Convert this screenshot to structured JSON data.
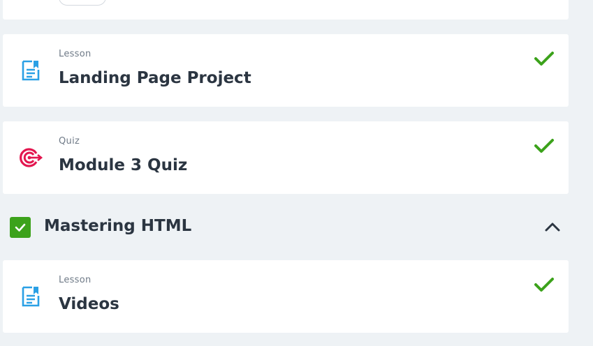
{
  "colors": {
    "background": "#eef2f5",
    "card": "#ffffff",
    "check_green": "#3ca21b",
    "lesson_blue": "#2aa0e5",
    "quiz_pink": "#e3164f",
    "text_dark": "#2b3541",
    "text_muted": "#6f7a87"
  },
  "items": [
    {
      "type": "Lesson",
      "title": "Landing Page Project",
      "icon": "lesson-document-icon",
      "completed": true
    },
    {
      "type": "Quiz",
      "title": "Module 3 Quiz",
      "icon": "quiz-target-icon",
      "completed": true
    }
  ],
  "section": {
    "title": "Mastering HTML",
    "completed": true,
    "expanded": true,
    "items": [
      {
        "type": "Lesson",
        "title": "Videos",
        "icon": "lesson-document-icon",
        "completed": true
      }
    ]
  }
}
